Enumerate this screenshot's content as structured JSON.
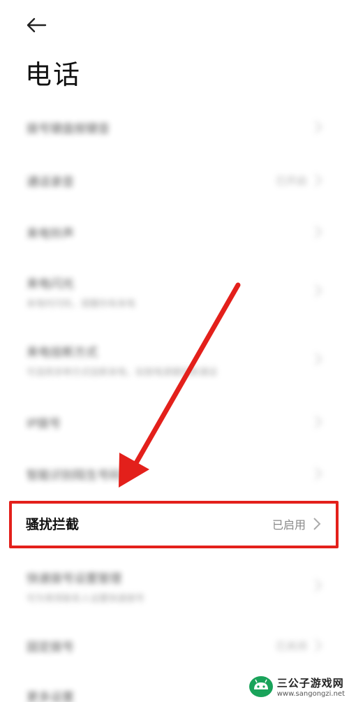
{
  "header": {
    "title": "电话"
  },
  "settings": {
    "blurred_rows": [
      {
        "label": "拨号键盘按键音",
        "sub": "",
        "value": ""
      },
      {
        "label": "通话录音",
        "sub": "",
        "value": "已开启"
      },
      {
        "label": "来电铃声",
        "sub": "",
        "value": ""
      },
      {
        "label": "来电闪光",
        "sub": "来电时闪烁，提醒你有来电",
        "value": ""
      },
      {
        "label": "来电挂断方式",
        "sub": "可选择多种方式挂断来电，如按电源键挂断通话",
        "value": ""
      },
      {
        "label": "IP拨号",
        "sub": "",
        "value": ""
      },
      {
        "label": "智能识别陌生号码",
        "sub": "",
        "value": ""
      }
    ],
    "highlighted": {
      "label": "骚扰拦截",
      "value": "已启用"
    },
    "below_rows": [
      {
        "label": "快速拨号设置管理",
        "sub": "可为常用联系人设置快速拨号",
        "value": ""
      },
      {
        "label": "固定拨号",
        "sub": "",
        "value": "已关闭"
      },
      {
        "label": "更多设置",
        "sub": "",
        "value": ""
      }
    ]
  },
  "watermark": {
    "name": "三公子游戏网",
    "url": "www.sangongzi.net"
  },
  "colors": {
    "highlight": "#e3201b",
    "brand": "#19a35a"
  }
}
